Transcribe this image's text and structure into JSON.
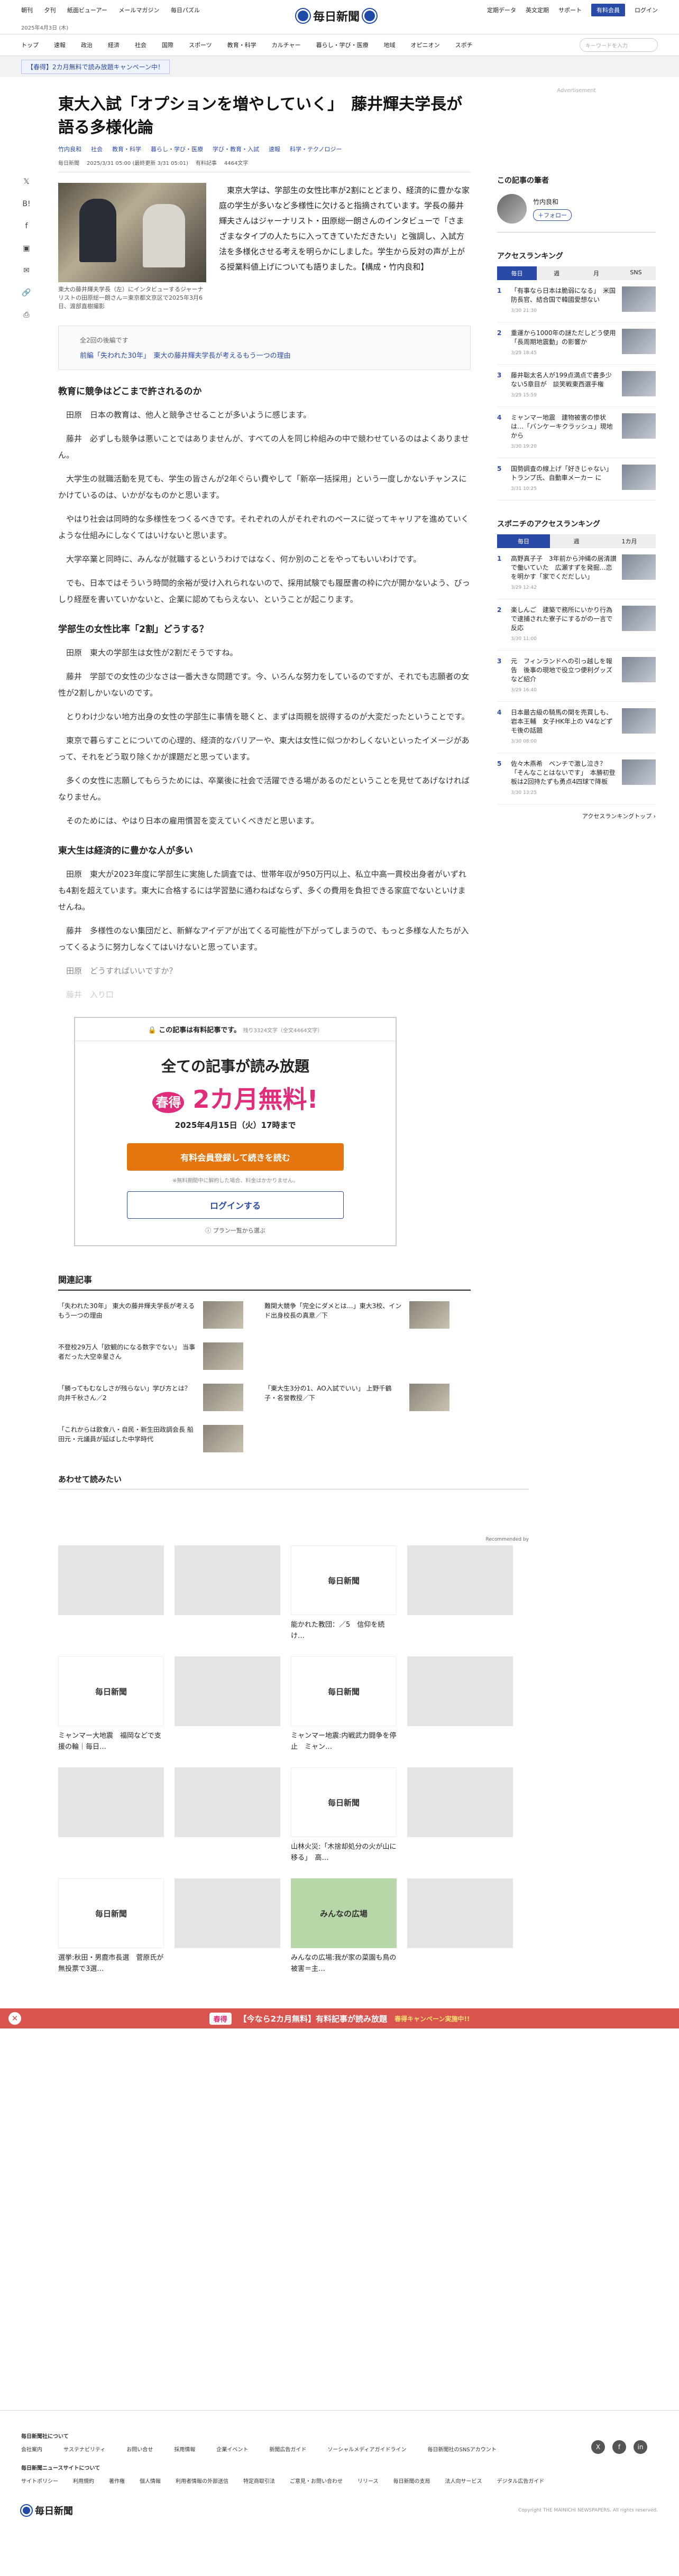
{
  "topbar": {
    "left": [
      "朝刊",
      "夕刊",
      "紙面ビューアー",
      "メールマガジン",
      "毎日パズル"
    ],
    "right": [
      "定期データ",
      "英文定期",
      "サポート"
    ],
    "subscribe": "有料会員",
    "login": "ログイン",
    "logo": "毎日新聞"
  },
  "date": "2025年4月3日 (木)",
  "nav": [
    "トップ",
    "速報",
    "政治",
    "経済",
    "社会",
    "国際",
    "スポーツ",
    "教育・科学",
    "カルチャー",
    "暮らし・学び・医療",
    "地域",
    "オピニオン",
    "スポチ"
  ],
  "search_placeholder": "キーワードを入力",
  "campaign": "【春得】2カ月無料で読み放題キャンペーン中！",
  "article": {
    "title": "東大入試「オプションを増やしていく」　藤井輝夫学長が語る多様化論",
    "meta_author": "竹内良和",
    "tags": [
      "社会",
      "教育・科学",
      "暮らし・学び・医療",
      "学び・教育・入試",
      "速報",
      "科学・テクノロジー"
    ],
    "meta_src": "毎日新聞",
    "meta_date": "2025/3/31 05:00 (最終更新 3/31 05:01)",
    "meta_type": "有料記事",
    "meta_chars": "4464文字",
    "caption": "東大の藤井輝夫学長（左）にインタビューするジャーナリストの田原総一朗さん＝東京都文京区で2025年3月6日、渡部直樹撮影",
    "lead": "　東京大学は、学部生の女性比率が2割にとどまり、経済的に豊かな家庭の学生が多いなど多様性に欠けると指摘されています。学長の藤井輝夫さんはジャーナリスト・田原総一朗さんのインタビューで「さまざまなタイプの人たちに入ってきていただきたい」と強調し、入試方法を多様化させる考えを明らかにしました。学生から反対の声が上がる授業料値上げについても語りました。【構成・竹内良和】",
    "series_count": "全2回の後編です",
    "series_link": "前編「失われた30年」　東大の藤井輝夫学長が考えるもう一つの理由",
    "h_1": "教育に競争はどこまで許されるのか",
    "p_1": "田原　日本の教育は、他人と競争させることが多いように感じます。",
    "p_2": "藤井　必ずしも競争は悪いことではありませんが、すべての人を同じ枠組みの中で競わせているのはよくありません。",
    "p_3": "大学生の就職活動を見ても、学生の皆さんが2年ぐらい費やして「新卒一括採用」という一度しかないチャンスにかけているのは、いかがなものかと思います。",
    "p_4": "やはり社会は同時的な多様性をつくるべきです。それぞれの人がそれぞれのペースに従ってキャリアを進めていくような仕組みにしなくてはいけないと思います。",
    "p_5": "大学卒業と同時に、みんなが就職するというわけではなく、何か別のことをやってもいいわけです。",
    "p_6": "でも、日本ではそういう時間的余裕が受け入れられないので、採用試験でも履歴書の枠に穴が開かないよう、びっしり経歴を書いていかないと、企業に認めてもらえない、ということが起こります。",
    "h_2": "学部生の女性比率「2割」どうする？",
    "p_7": "田原　東大の学部生は女性が2割だそうですね。",
    "p_8": "藤井　学部での女性の少なさは一番大きな問題です。今、いろんな努力をしているのですが、それでも志願者の女性が2割しかいないのです。",
    "p_9": "とりわけ少ない地方出身の女性の学部生に事情を聴くと、まずは両親を説得するのが大変だったということです。",
    "p_10": "東京で暮らすことについての心理的、経済的なバリアーや、東大は女性に似つかわしくないといったイメージがあって、それをどう取り除くかが課題だと思っています。",
    "p_11": "多くの女性に志願してもらうためには、卒業後に社会で活躍できる場があるのだということを見せてあげなければなりません。",
    "p_12": "そのためには、やはり日本の雇用慣習を変えていくべきだと思います。",
    "h_3": "東大生は経済的に豊かな人が多い",
    "p_13": "田原　東大が2023年度に学部生に実施した調査では、世帯年収が950万円以上、私立中高一貫校出身者がいずれも4割を超えています。東大に合格するには学習塾に通わねばならず、多くの費用を負担できる家庭でないといけませんね。",
    "p_14": "藤井　多様性のない集団だと、新鮮なアイデアが出てくる可能性が下がってしまうので、もっと多様な人たちが入ってくるように努力しなくてはいけないと思っています。",
    "p_15": "田原　どうすればいいですか？",
    "p_16": "藤井　入り口"
  },
  "paywall": {
    "top": "この記事は有料記事です。",
    "top_small": "残り3324文字（全文4464文字）",
    "headline": "全ての記事が読み放題",
    "badge": "春得",
    "promo": "2カ月無料!",
    "deadline": "2025年4月15日（火）17時まで",
    "cta": "有料会員登録して続きを読む",
    "note": "※無料期間中に解約した場合、料金はかかりません。",
    "login": "ログインする",
    "plan": "プラン一覧から選ぶ"
  },
  "related": {
    "title": "関連記事",
    "items": [
      "「失われた30年」 東大の藤井輝夫学長が考えるもう一つの理由",
      "難関大競争「完全にダメとは…」東大3校、インド出身校長の真意／下",
      "不登校29万人「欧観的になる数字でない」 当事者だった大空幸星さん",
      "",
      "「勝ってもむなしさが残らない」学び方とは？ 向井千秋さん／2",
      "「東大生3分の1、AO入試でいい」 上野千鶴子・名誉教授／下",
      "「これからは飲食八・自民・新生田政調会長 船田元・元議員が延ばした中学時代",
      ""
    ]
  },
  "recommend": {
    "title": "あわせて読みたい",
    "by": "Recommended by",
    "cards": [
      {
        "title": "",
        "img": ""
      },
      {
        "title": "",
        "img": ""
      },
      {
        "title": "能かれた教団：／5　信仰を続け…",
        "img": "毎日新聞"
      },
      {
        "title": "",
        "img": ""
      },
      {
        "title": "ミャンマー大地震　福岡などで支援の輪｜毎日…",
        "img": "毎日新聞"
      },
      {
        "title": "",
        "img": ""
      },
      {
        "title": "ミャンマー地震:内戦武力闘争を停止　ミャン…",
        "img": "毎日新聞"
      },
      {
        "title": "",
        "img": ""
      },
      {
        "title": "",
        "img": ""
      },
      {
        "title": "",
        "img": ""
      },
      {
        "title": "山林火災:「木捨却処分の火が山に移る」　高…",
        "img": "毎日新聞"
      },
      {
        "title": "",
        "img": ""
      },
      {
        "title": "選挙:秋田・男鹿市長選　菅原氏が無投票で3選…",
        "img": "毎日新聞"
      },
      {
        "title": "",
        "img": ""
      },
      {
        "title": "みんなの広場:我が家の菜園も鳥の被害＝主…",
        "img": "みんなの広場"
      },
      {
        "title": "",
        "img": ""
      }
    ]
  },
  "bottom_ad": {
    "badge": "春得",
    "text": "【今なら2カ月無料】有料記事が読み放題",
    "right": "春得キャンペーン実施中!!"
  },
  "sidebar": {
    "adv": "Advertisement",
    "author_title": "この記事の筆者",
    "author_name": "竹内良和",
    "follow": "＋フォロー",
    "ranking_title": "アクセスランキング",
    "tabs": [
      "毎日",
      "週",
      "月",
      "SNS"
    ],
    "ranking": [
      {
        "t": "「有事なら日本は脆弱になる」　米国防長官、結合国で韓國愛想ない",
        "d": "3/30 21:30"
      },
      {
        "t": "重運から1000年の謎ただしどう使用　「長周期地震動」の影響か",
        "d": "3/29 18:45"
      },
      {
        "t": "藤井聡太名人が199点満点で書多少ない5章目が　談笑戦東西選手権",
        "d": "3/29 15:59"
      },
      {
        "t": "ミャンマー地震　建物被害の惨状は…「バンケーキクラッシュ」現地から",
        "d": "3/30 19:20"
      },
      {
        "t": "国勢調査の線上げ「好きじゃない」トランプ氏、自動車メーカー に",
        "d": "3/31 10:25"
      }
    ],
    "sports_title": "スポニチのアクセスランキング",
    "sports_tabs": [
      "毎日",
      "週",
      "1カ月"
    ],
    "sports": [
      {
        "t": "高野真子子　3年前から沖縄の居清讃で働いていた　広瀬すずを発掘…恋を明かす「家でくだだしい」",
        "d": "3/29 12:42"
      },
      {
        "t": "楽しんご　建築で務所にいかり行為で逮捕された寮子にするがの一言で反応",
        "d": "3/30 11:00"
      },
      {
        "t": "元　フィンランドへの引っ越しを報告　後事の現地で役立つ便利グッズなど紹介",
        "d": "3/29 16:40"
      },
      {
        "t": "日本最古級の騎馬の関を売買しも、岩本王輔　女子HK年上の V4などずモ後の話題",
        "d": "3/30 08:00"
      },
      {
        "t": "佐々木燕希　ベンチで激し泣き？「そんなことはないです」　本勝初登板は2回持たずも勇点4四球で降板",
        "d": "3/30 13:25"
      }
    ],
    "more": "アクセスランキングトップ"
  },
  "footer": {
    "group1": "毎日新聞社について",
    "links1": [
      "会社案内",
      "サステナビリティ",
      "お問い合せ",
      "採用情報",
      "企業イベント",
      "新聞広告ガイド",
      "ソーシャルメディアガイドライン",
      "毎日新聞社のSNSアカウント"
    ],
    "group2": "毎日新聞ニュースサイトについて",
    "links2": [
      "サイトポリシー",
      "利用規約",
      "著作権",
      "個人情報",
      "利用者情報の外部送信",
      "特定商取引法",
      "ご意見・お問い合わせ",
      "リリース",
      "毎日新聞の支局",
      "法人向サービス",
      "デジタル広告ガイド"
    ],
    "social": [
      "X",
      "f",
      "in"
    ],
    "copyright": "Copyright THE MAINICHI NEWSPAPERS. All rights reserved."
  }
}
